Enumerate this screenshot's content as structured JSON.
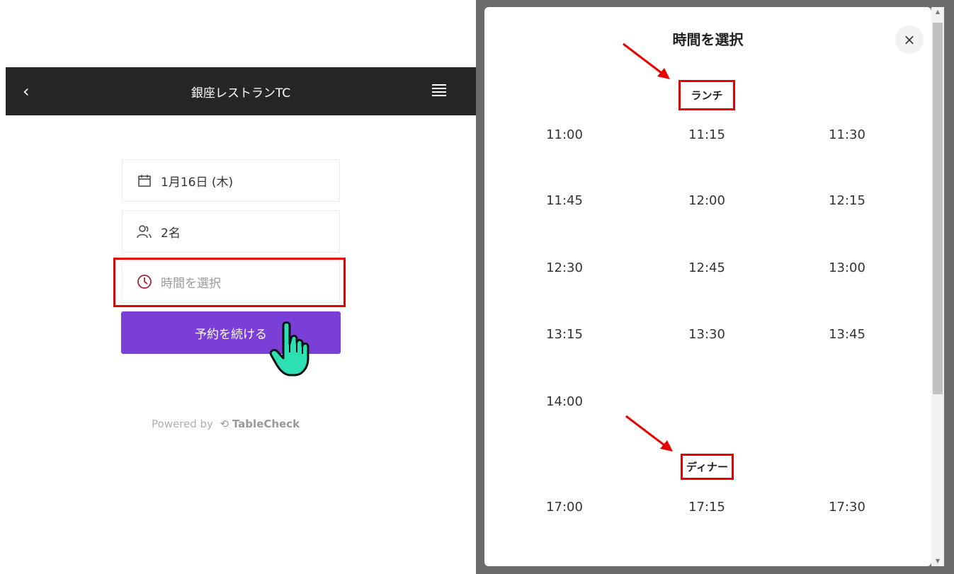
{
  "left": {
    "header": {
      "back_icon": "chevron-left-icon",
      "title": "銀座レストランTC",
      "menu_icon": "hamburger-icon"
    },
    "fields": {
      "date": {
        "icon": "calendar-icon",
        "value": "1月16日 (木)"
      },
      "people": {
        "icon": "people-icon",
        "value": "2名"
      },
      "time": {
        "icon": "clock-icon",
        "placeholder": "時間を選択"
      }
    },
    "continue_button": "予約を続ける",
    "powered_by": {
      "prefix": "Powered by",
      "brand": "TableCheck"
    }
  },
  "modal": {
    "title": "時間を選択",
    "close_label": "×",
    "sections": [
      {
        "label": "ランチ",
        "slots": [
          "11:00",
          "11:15",
          "11:30",
          "11:45",
          "12:00",
          "12:15",
          "12:30",
          "12:45",
          "13:00",
          "13:15",
          "13:30",
          "13:45",
          "14:00"
        ]
      },
      {
        "label": "ディナー",
        "slots": [
          "17:00",
          "17:15",
          "17:30"
        ]
      }
    ]
  },
  "colors": {
    "header_bg": "#262626",
    "accent": "#7a3fd6",
    "highlight": "#e60000",
    "clock": "#a0263a"
  }
}
